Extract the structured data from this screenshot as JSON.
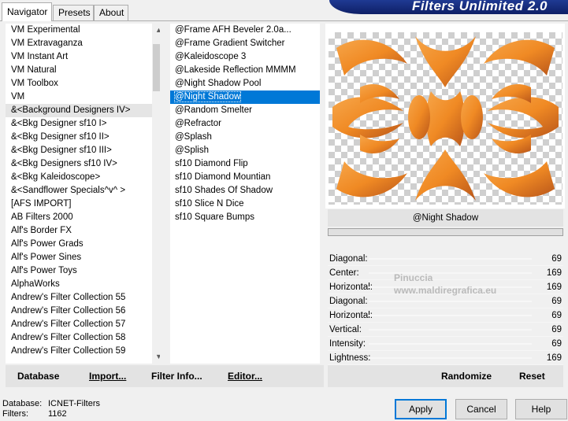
{
  "tabs": [
    {
      "label": "Navigator"
    },
    {
      "label": "Presets"
    },
    {
      "label": "About"
    }
  ],
  "banner": {
    "title": "Filters Unlimited 2.0"
  },
  "categories": [
    "VM Experimental",
    "VM Extravaganza",
    "VM Instant Art",
    "VM Natural",
    "VM Toolbox",
    "VM",
    "&<Background Designers IV>",
    "&<Bkg Designer sf10 I>",
    "&<Bkg Designer sf10 II>",
    "&<Bkg Designer sf10 III>",
    "&<Bkg Designers sf10 IV>",
    "&<Bkg Kaleidoscope>",
    "&<Sandflower Specials^v^ >",
    "[AFS IMPORT]",
    "AB Filters 2000",
    "Alf's Border FX",
    "Alf's Power Grads",
    "Alf's Power Sines",
    "Alf's Power Toys",
    "AlphaWorks",
    "Andrew's Filter Collection 55",
    "Andrew's Filter Collection 56",
    "Andrew's Filter Collection 57",
    "Andrew's Filter Collection 58",
    "Andrew's Filter Collection 59"
  ],
  "filters": [
    "@Frame AFH Beveler 2.0a...",
    "@Frame Gradient Switcher",
    "@Kaleidoscope 3",
    "@Lakeside Reflection MMMM",
    "@Night Shadow Pool",
    "@Night Shadow",
    "@Random Smelter",
    "@Refractor",
    "@Splash",
    "@Splish",
    "sf10 Diamond Flip",
    "sf10 Diamond Mountian",
    "sf10 Shades Of Shadow",
    "sf10 Slice N Dice",
    "sf10 Square Bumps"
  ],
  "selected_filter": "@Night Shadow",
  "selected_category": "&<Background Designers IV>",
  "params": [
    {
      "name": "Diagonal:",
      "value": "69"
    },
    {
      "name": "Center:",
      "value": "169"
    },
    {
      "name": "Horizontal:",
      "value": "169"
    },
    {
      "name": "Diagonal:",
      "value": "69"
    },
    {
      "name": "Horizontal:",
      "value": "69"
    },
    {
      "name": "Vertical:",
      "value": "69"
    },
    {
      "name": "Intensity:",
      "value": "69"
    },
    {
      "name": "Lightness:",
      "value": "169"
    }
  ],
  "left_buttons": {
    "database": "Database",
    "import": "Import...",
    "filter_info": "Filter Info...",
    "editor": "Editor..."
  },
  "right_buttons": {
    "randomize": "Randomize",
    "reset": "Reset"
  },
  "status": {
    "database_label": "Database:",
    "database_value": "ICNET-Filters",
    "filters_label": "Filters:",
    "filters_value": "1162"
  },
  "dialog_buttons": {
    "apply": "Apply",
    "cancel": "Cancel",
    "help": "Help"
  },
  "watermark": {
    "line1": "Pinuccia",
    "line2": "www.maldiregrafica.eu"
  },
  "colors": {
    "selection": "#0078d7",
    "banner": "#1f3a93",
    "ornament": "#f08a24"
  }
}
